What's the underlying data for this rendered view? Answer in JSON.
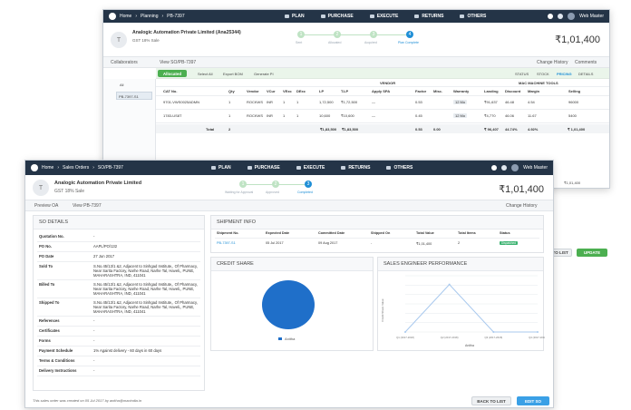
{
  "back_window": {
    "nav": {
      "home": "Home",
      "section": "Planning",
      "record": "PB-7397",
      "menu": [
        "PLAN",
        "PURCHASE",
        "EXECUTE",
        "RETURNS",
        "OTHERS"
      ],
      "user": "Web Master"
    },
    "header": {
      "initial": "T",
      "customer": "Analogic Automation Private Limited (Ana25344)",
      "gst": "GST 18% Sale",
      "amount": "₹1,01,400"
    },
    "steps": [
      "Sent",
      "Allocated",
      "Acquired",
      "Plan Complete"
    ],
    "steps_current": 4,
    "subnav": {
      "collaborators": "Collaborators",
      "view": "View SO/PB-7397",
      "change_history": "Change History",
      "comments": "Comments"
    },
    "toolbar": {
      "allocated": "Allocated",
      "select_all": "Select All",
      "export_bom": "Export BOM",
      "generate_pi": "Generate PI",
      "tabs": [
        "STATUS",
        "STOCK",
        "PRICING",
        "DETAILS"
      ],
      "active_tab": "PRICING"
    },
    "side": {
      "all": "All",
      "item": "PB-7397-S1"
    },
    "group_headers": {
      "vendor": "VENDOR",
      "mac": "MAC MACHINE TOOLS"
    },
    "columns": [
      "CAT No.",
      "Qty",
      "Vendor",
      "VCur",
      "VExc",
      "DExc",
      "LP",
      "T.LP",
      "Apply SPA",
      "Factor",
      "Misc.",
      "Warranty",
      "Landing",
      "Discount",
      "Margin",
      "Selling"
    ],
    "rows": [
      [
        "9701-VWS0025ADMN",
        "1",
        "ROCKWS",
        "INR",
        "1",
        "1",
        "1,72,500",
        "₹1,72,500",
        "—",
        "0.53",
        "",
        "12 Mo",
        "₹91,637",
        "46.48",
        "4.54",
        "96000"
      ],
      [
        "1783-US8T",
        "1",
        "ROCKWS",
        "INR",
        "1",
        "1",
        "10,600",
        "₹10,600",
        "—",
        "0.45",
        "",
        "12 Mo",
        "₹4,770",
        "46.06",
        "11.67",
        "5400"
      ]
    ],
    "total": {
      "label": "Total",
      "qty": "2",
      "lp": "₹1,83,500",
      "tlp": "₹1,83,500",
      "factor": "0.53",
      "misc": "0.00",
      "landing": "₹ 96,407",
      "discount": "44.74%",
      "margin": "4.92%",
      "selling": "₹ 1,01,400"
    },
    "footer_amount": "₹1,01,400",
    "back_to_list": "BACK TO LIST",
    "update": "UPDATE"
  },
  "front_window": {
    "nav": {
      "home": "Home",
      "section": "Sales Orders",
      "record": "SO/PB-7397",
      "menu": [
        "PLAN",
        "PURCHASE",
        "EXECUTE",
        "RETURNS",
        "OTHERS"
      ],
      "user": "Web Master"
    },
    "header": {
      "initial": "T",
      "customer": "Analogic Automation Private Limited",
      "gst": "GST 18% Sale",
      "amount": "₹1,01,400"
    },
    "steps": [
      "Waiting for Approval",
      "Approved",
      "Completed"
    ],
    "steps_current": 3,
    "subnav": {
      "preview_oa": "Preview OA",
      "view": "View PB-7397",
      "change_history": "Change History"
    },
    "so_details": {
      "title": "SO DETAILS",
      "fields": [
        {
          "k": "Quotation No.",
          "v": "-"
        },
        {
          "k": "PO No.",
          "v": "AAPL/PO/132"
        },
        {
          "k": "PO Date",
          "v": "27 Jun 2017"
        },
        {
          "k": "Sold To",
          "v": "S.No.45/13/1 &2, Adjacent to Sinhgad Institute,, Of Pharmacy, Near Sarita Factory, Narhe Road, Narhe Tal, Haveli,, PUNE, MAHARASHTRA, IND, 411041"
        },
        {
          "k": "Billed To",
          "v": "S.No.45/13/1 &2, Adjacent to Sinhgad Institute,, Of Pharmacy, Near Sarita Factory, Narhe Road, Narhe Tal, Haveli,, PUNE, MAHARASHTRA, IND, 411041"
        },
        {
          "k": "Shipped To",
          "v": "S.No.45/13/1 &2, Adjacent to Sinhgad Institute,, Of Pharmacy, Near Sarita Factory, Narhe Road, Narhe Tal, Haveli,, PUNE, MAHARASHTRA, IND, 411041"
        },
        {
          "k": "References",
          "v": "-"
        },
        {
          "k": "Certificates",
          "v": "-"
        },
        {
          "k": "Forms",
          "v": "-"
        },
        {
          "k": "Payment Schedule",
          "v": "1% Against delivery - 60 days in 60 days"
        },
        {
          "k": "Terms & Conditions",
          "v": "-"
        },
        {
          "k": "Delivery Instructions",
          "v": "-"
        }
      ]
    },
    "shipment": {
      "title": "SHIPMENT INFO",
      "columns": [
        "Shipment No.",
        "Expected Date",
        "Committed Date",
        "Shipped On",
        "Total Value",
        "Total Items",
        "Status"
      ],
      "row": [
        "PB-7397-S1",
        "05 Jul 2017",
        "09 Aug 2017",
        "-",
        "₹1,01,400",
        "2",
        "Dispatched"
      ],
      "status_color": "#3cb371"
    },
    "credit_share": {
      "title": "CREDIT SHARE",
      "legend": "Anitha",
      "color": "#1f6fc9"
    },
    "performance": {
      "title": "SALES ENGINEER PERFORMANCE",
      "legend": "Anitha",
      "ylabel": "Credit Share Value"
    },
    "footer_note": "This sales order was created on 05 Jul 2017 by anitha@macindia.in",
    "back_to_list": "BACK TO LIST",
    "edit_so": "EDIT SO"
  },
  "chart_data": [
    {
      "type": "pie",
      "title": "CREDIT SHARE",
      "labels": [
        "Anitha"
      ],
      "values": [
        100
      ]
    },
    {
      "type": "line",
      "title": "SALES ENGINEER PERFORMANCE",
      "xlabel": "",
      "ylabel": "Credit Share Value",
      "categories": [
        "Q1 (2017-2018)",
        "Q2 (2017-2018)",
        "Q3 (2017-2018)",
        "Q4 (2017-2018)"
      ],
      "series": [
        {
          "name": "Anitha",
          "values": [
            0,
            101400,
            0,
            0
          ]
        }
      ],
      "ylim": [
        0,
        120000
      ],
      "grid": true
    }
  ],
  "colors": {
    "nav": "#243447",
    "accent": "#1f8fd6",
    "green": "#4caf50",
    "pie": "#1f6fc9",
    "line": "#a9c9ee"
  }
}
